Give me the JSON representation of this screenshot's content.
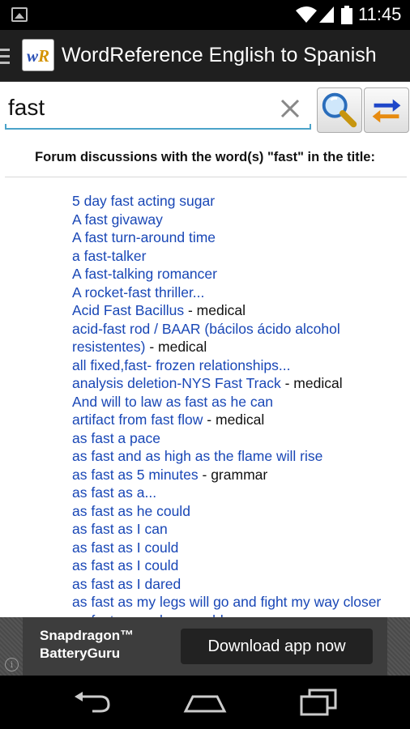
{
  "status_bar": {
    "time": "11:45",
    "icons": [
      "gallery-icon",
      "wifi-icon",
      "signal-icon",
      "battery-icon"
    ]
  },
  "action_bar": {
    "logo_w": "w",
    "logo_r": "R",
    "title": "WordReference English to Spanish"
  },
  "search": {
    "value": "fast"
  },
  "forum": {
    "heading": "Forum discussions with the word(s) \"fast\" in the title:",
    "items": [
      {
        "link": "5 day fast acting sugar",
        "tag": ""
      },
      {
        "link": "A fast givaway",
        "tag": ""
      },
      {
        "link": "A fast turn-around time",
        "tag": ""
      },
      {
        "link": "a fast-talker",
        "tag": ""
      },
      {
        "link": "A fast-talking romancer",
        "tag": ""
      },
      {
        "link": "A rocket-fast thriller...",
        "tag": ""
      },
      {
        "link": "Acid Fast Bacillus",
        "tag": " - medical"
      },
      {
        "link": "acid-fast rod / BAAR (bácilos ácido alcohol resistentes)",
        "tag": " - medical"
      },
      {
        "link": "all fixed,fast- frozen relationships...",
        "tag": ""
      },
      {
        "link": "analysis deletion-NYS Fast Track",
        "tag": " - medical"
      },
      {
        "link": "And will to law as fast as he can",
        "tag": ""
      },
      {
        "link": "artifact from fast flow",
        "tag": " - medical"
      },
      {
        "link": "as fast a pace",
        "tag": ""
      },
      {
        "link": "as fast and as high as the flame will rise",
        "tag": ""
      },
      {
        "link": "as fast as 5 minutes",
        "tag": " - grammar"
      },
      {
        "link": "as fast as a...",
        "tag": ""
      },
      {
        "link": "as fast as he could",
        "tag": ""
      },
      {
        "link": "as fast as I can",
        "tag": ""
      },
      {
        "link": "as fast as I could",
        "tag": ""
      },
      {
        "link": "as fast as I could",
        "tag": ""
      },
      {
        "link": "as fast as I dared",
        "tag": ""
      },
      {
        "link": "as fast as my legs will go and fight my way closer",
        "tag": ""
      },
      {
        "link": "as fast as my legs could",
        "tag": ""
      }
    ]
  },
  "ad": {
    "brand_line1": "Snapdragon™",
    "brand_line2": "BatteryGuru",
    "cta": "Download app now",
    "info": "i"
  },
  "nav": {
    "icons": [
      "back-icon",
      "home-icon",
      "recent-apps-icon"
    ]
  },
  "colors": {
    "link": "#1947b6",
    "accent": "#4ba3c9",
    "action_bar": "#1f1f1f"
  }
}
